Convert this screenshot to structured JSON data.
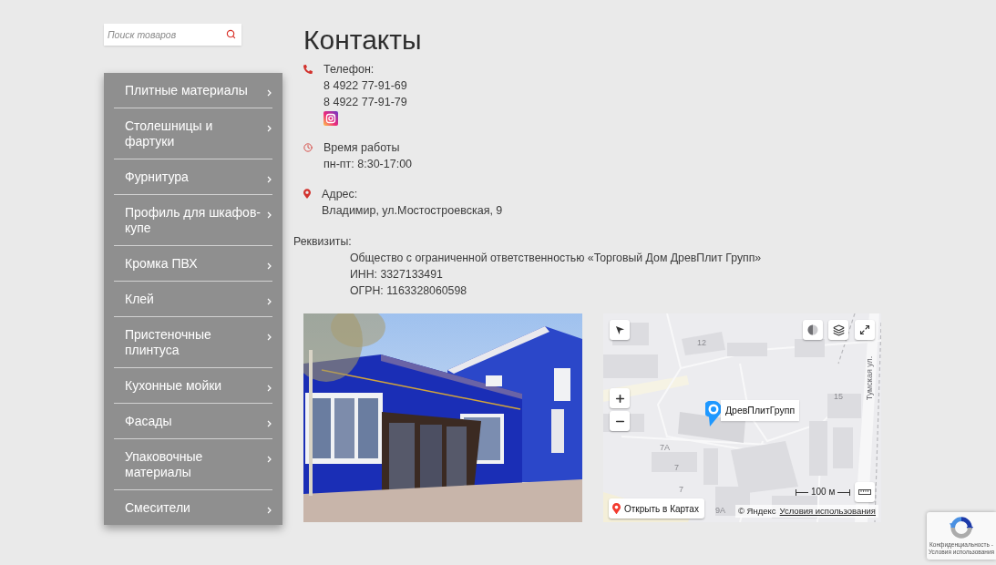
{
  "search": {
    "placeholder": "Поиск товаров"
  },
  "sidebar": {
    "items": [
      {
        "label": "Плитные материалы"
      },
      {
        "label": "Столешницы и фартуки"
      },
      {
        "label": "Фурнитура"
      },
      {
        "label": "Профиль для шкафов-купе"
      },
      {
        "label": "Кромка ПВХ"
      },
      {
        "label": "Клей"
      },
      {
        "label": "Пристеночные плинтуса"
      },
      {
        "label": "Кухонные мойки"
      },
      {
        "label": "Фасады"
      },
      {
        "label": "Упаковочные материалы"
      },
      {
        "label": "Смесители"
      }
    ]
  },
  "page": {
    "title": "Контакты"
  },
  "contacts": [
    {
      "kind": "phone",
      "label": "Телефон:",
      "lines": [
        "8 4922 77-91-69",
        "8 4922 77-91-79"
      ],
      "links": [
        {
          "kind": "instagram"
        }
      ]
    },
    {
      "kind": "hours",
      "label": "Время работы",
      "lines": [
        "пн-пт: 8:30-17:00"
      ]
    },
    {
      "kind": "address",
      "label": "Адрес:",
      "lines": [
        "Владимир, ул.Мостостроевская, 9"
      ]
    }
  ],
  "requisites": {
    "label": "Реквизиты:",
    "lines": [
      "Общество с ограниченной ответственностью «Торговый Дом ДревПлит Групп»",
      "ИНН: 3327133491",
      "ОГРН: 1163328060598"
    ]
  },
  "map": {
    "labels": [
      "12",
      "15",
      "7А",
      "7",
      "7",
      "9А"
    ],
    "street": "Тумская ул.",
    "placemark": "ДревПлитГрупп",
    "open_button": "Открыть в Картах",
    "scale": "100 м",
    "copyright": "© Яндекс",
    "terms_link": "Условия использования"
  },
  "badge": {
    "lines": [
      "Конфиденциальность -",
      "Условия использования"
    ]
  }
}
